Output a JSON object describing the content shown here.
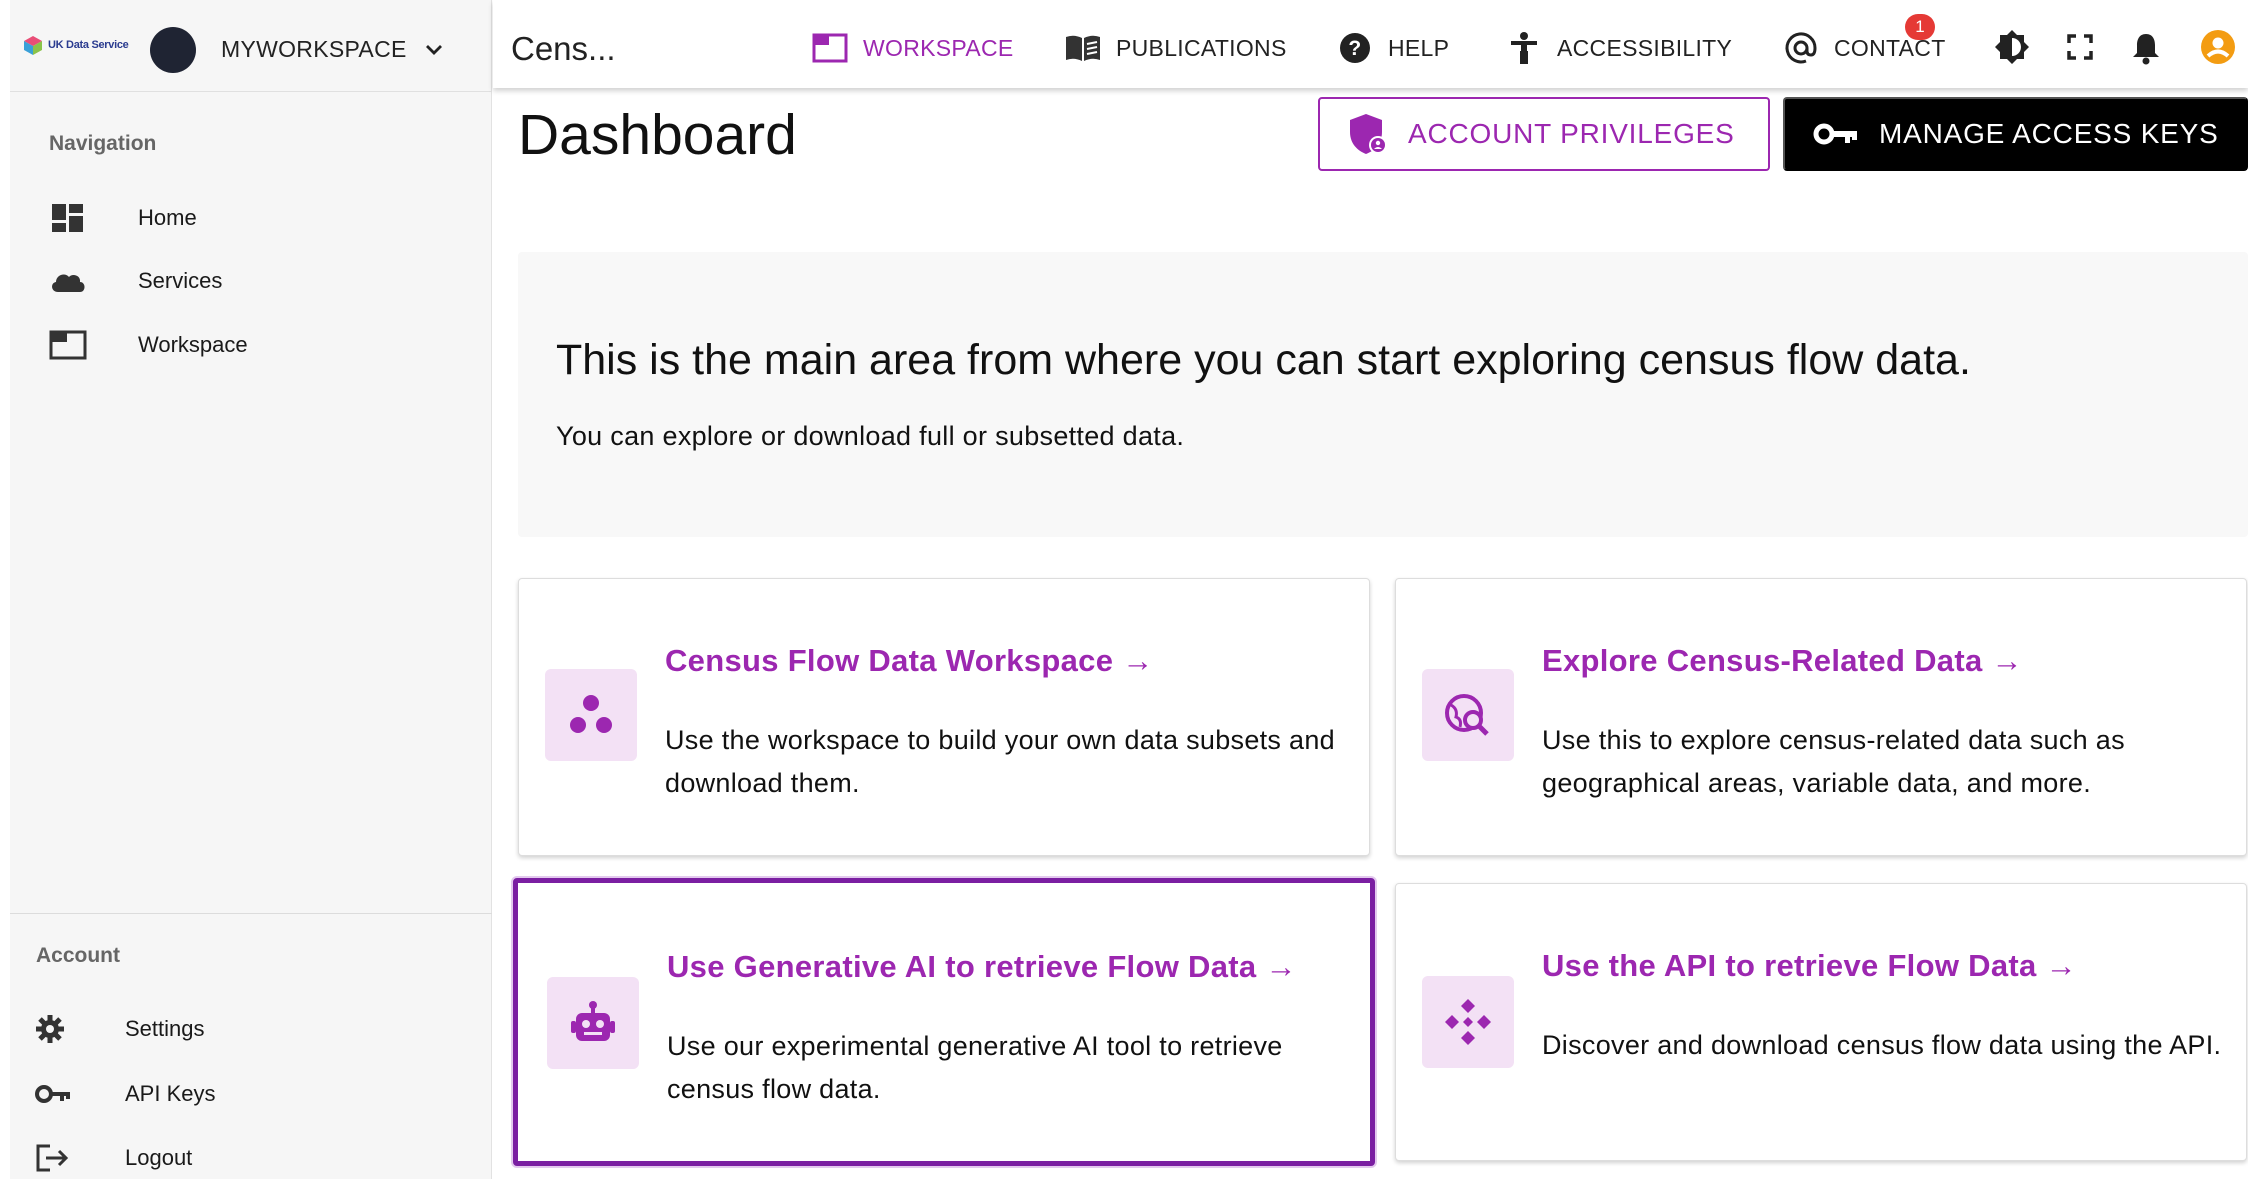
{
  "brand": {
    "logo_text": "UK Data Service"
  },
  "workspace": {
    "name": "MYWORKSPACE"
  },
  "sidebar": {
    "nav_title": "Navigation",
    "items": [
      {
        "label": "Home",
        "icon": "dashboard-icon"
      },
      {
        "label": "Services",
        "icon": "cloud-icon"
      },
      {
        "label": "Workspace",
        "icon": "window-icon"
      }
    ],
    "account_title": "Account",
    "account_items": [
      {
        "label": "Settings",
        "icon": "gear-icon"
      },
      {
        "label": "API Keys",
        "icon": "key-icon"
      },
      {
        "label": "Logout",
        "icon": "logout-icon"
      }
    ]
  },
  "topbar": {
    "crumb": "Cens...",
    "nav": [
      {
        "label": "WORKSPACE",
        "active": true
      },
      {
        "label": "PUBLICATIONS",
        "active": false
      },
      {
        "label": "HELP",
        "active": false
      },
      {
        "label": "ACCESSIBILITY",
        "active": false
      },
      {
        "label": "CONTACT",
        "active": false
      }
    ],
    "notifications_count": "1"
  },
  "main": {
    "title": "Dashboard",
    "privileges_label": "ACCOUNT PRIVILEGES",
    "access_keys_label": "MANAGE ACCESS KEYS",
    "hero_heading": "This is the main area from where you can start exploring census flow data.",
    "hero_text": "You can explore or download full or subsetted data.",
    "cards": [
      {
        "title": "Census Flow Data Workspace →",
        "text": "Use the workspace to build your own data subsets and download them.",
        "icon": "dots-icon"
      },
      {
        "title": "Explore Census-Related Data →",
        "text": "Use this to explore census-related data such as geographical areas, variable data, and more.",
        "icon": "globe-search-icon"
      },
      {
        "title": "Use Generative AI to retrieve Flow Data →",
        "text": "Use our experimental generative AI tool to retrieve census flow data.",
        "icon": "robot-icon"
      },
      {
        "title": "Use the API to retrieve Flow Data →",
        "text": "Discover and download census flow data using the API.",
        "icon": "api-icon"
      }
    ]
  },
  "colors": {
    "accent": "#9c27b0",
    "badge": "#e53935",
    "avatar": "#f39c12"
  }
}
